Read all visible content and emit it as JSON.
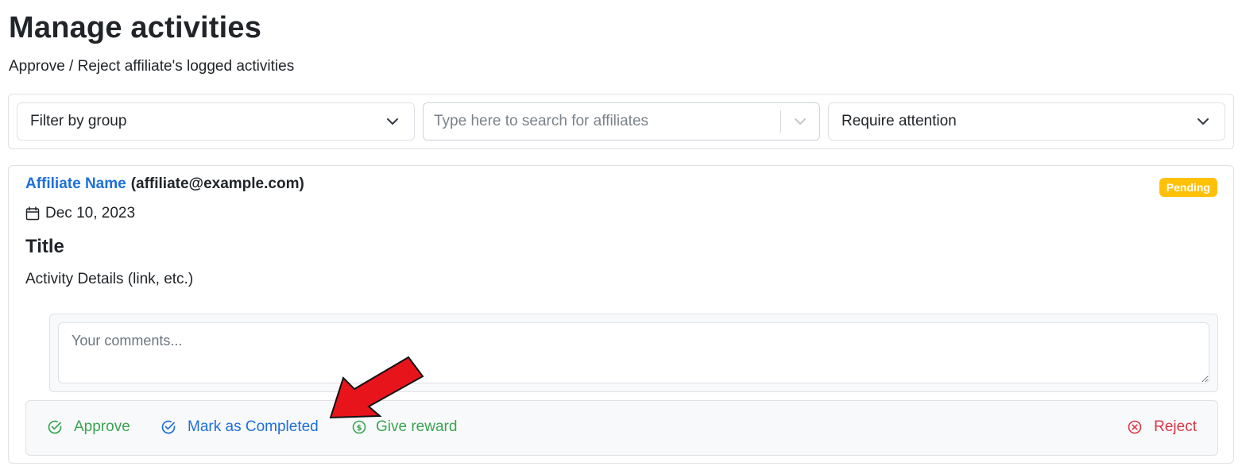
{
  "page": {
    "title": "Manage activities",
    "subtitle": "Approve / Reject affiliate's logged activities"
  },
  "filters": {
    "group_select": {
      "label": "Filter by group",
      "icon": "chevron-down-icon"
    },
    "affiliate_search": {
      "placeholder": "Type here to search for affiliates",
      "icon": "chevron-down-icon"
    },
    "status_select": {
      "label": "Require attention",
      "icon": "chevron-down-icon"
    }
  },
  "activity": {
    "affiliate_name": "Affiliate Name",
    "affiliate_email": "(affiliate@example.com)",
    "status_badge": "Pending",
    "date_icon": "calendar-icon",
    "date": "Dec 10, 2023",
    "title": "Title",
    "details": "Activity Details (link, etc.)",
    "comment_placeholder": "Your comments..."
  },
  "actions": {
    "approve": {
      "label": "Approve",
      "icon": "check-circle-icon"
    },
    "complete": {
      "label": "Mark as Completed",
      "icon": "check-circle-icon"
    },
    "reward": {
      "label": "Give reward",
      "icon": "dollar-circle-icon"
    },
    "reject": {
      "label": "Reject",
      "icon": "x-circle-icon"
    }
  },
  "colors": {
    "link_blue": "#1e6fd9",
    "success_green": "#3aa451",
    "danger_red": "#dc3545",
    "warning_yellow": "#ffc107",
    "annotation_arrow": "#e8141b"
  }
}
